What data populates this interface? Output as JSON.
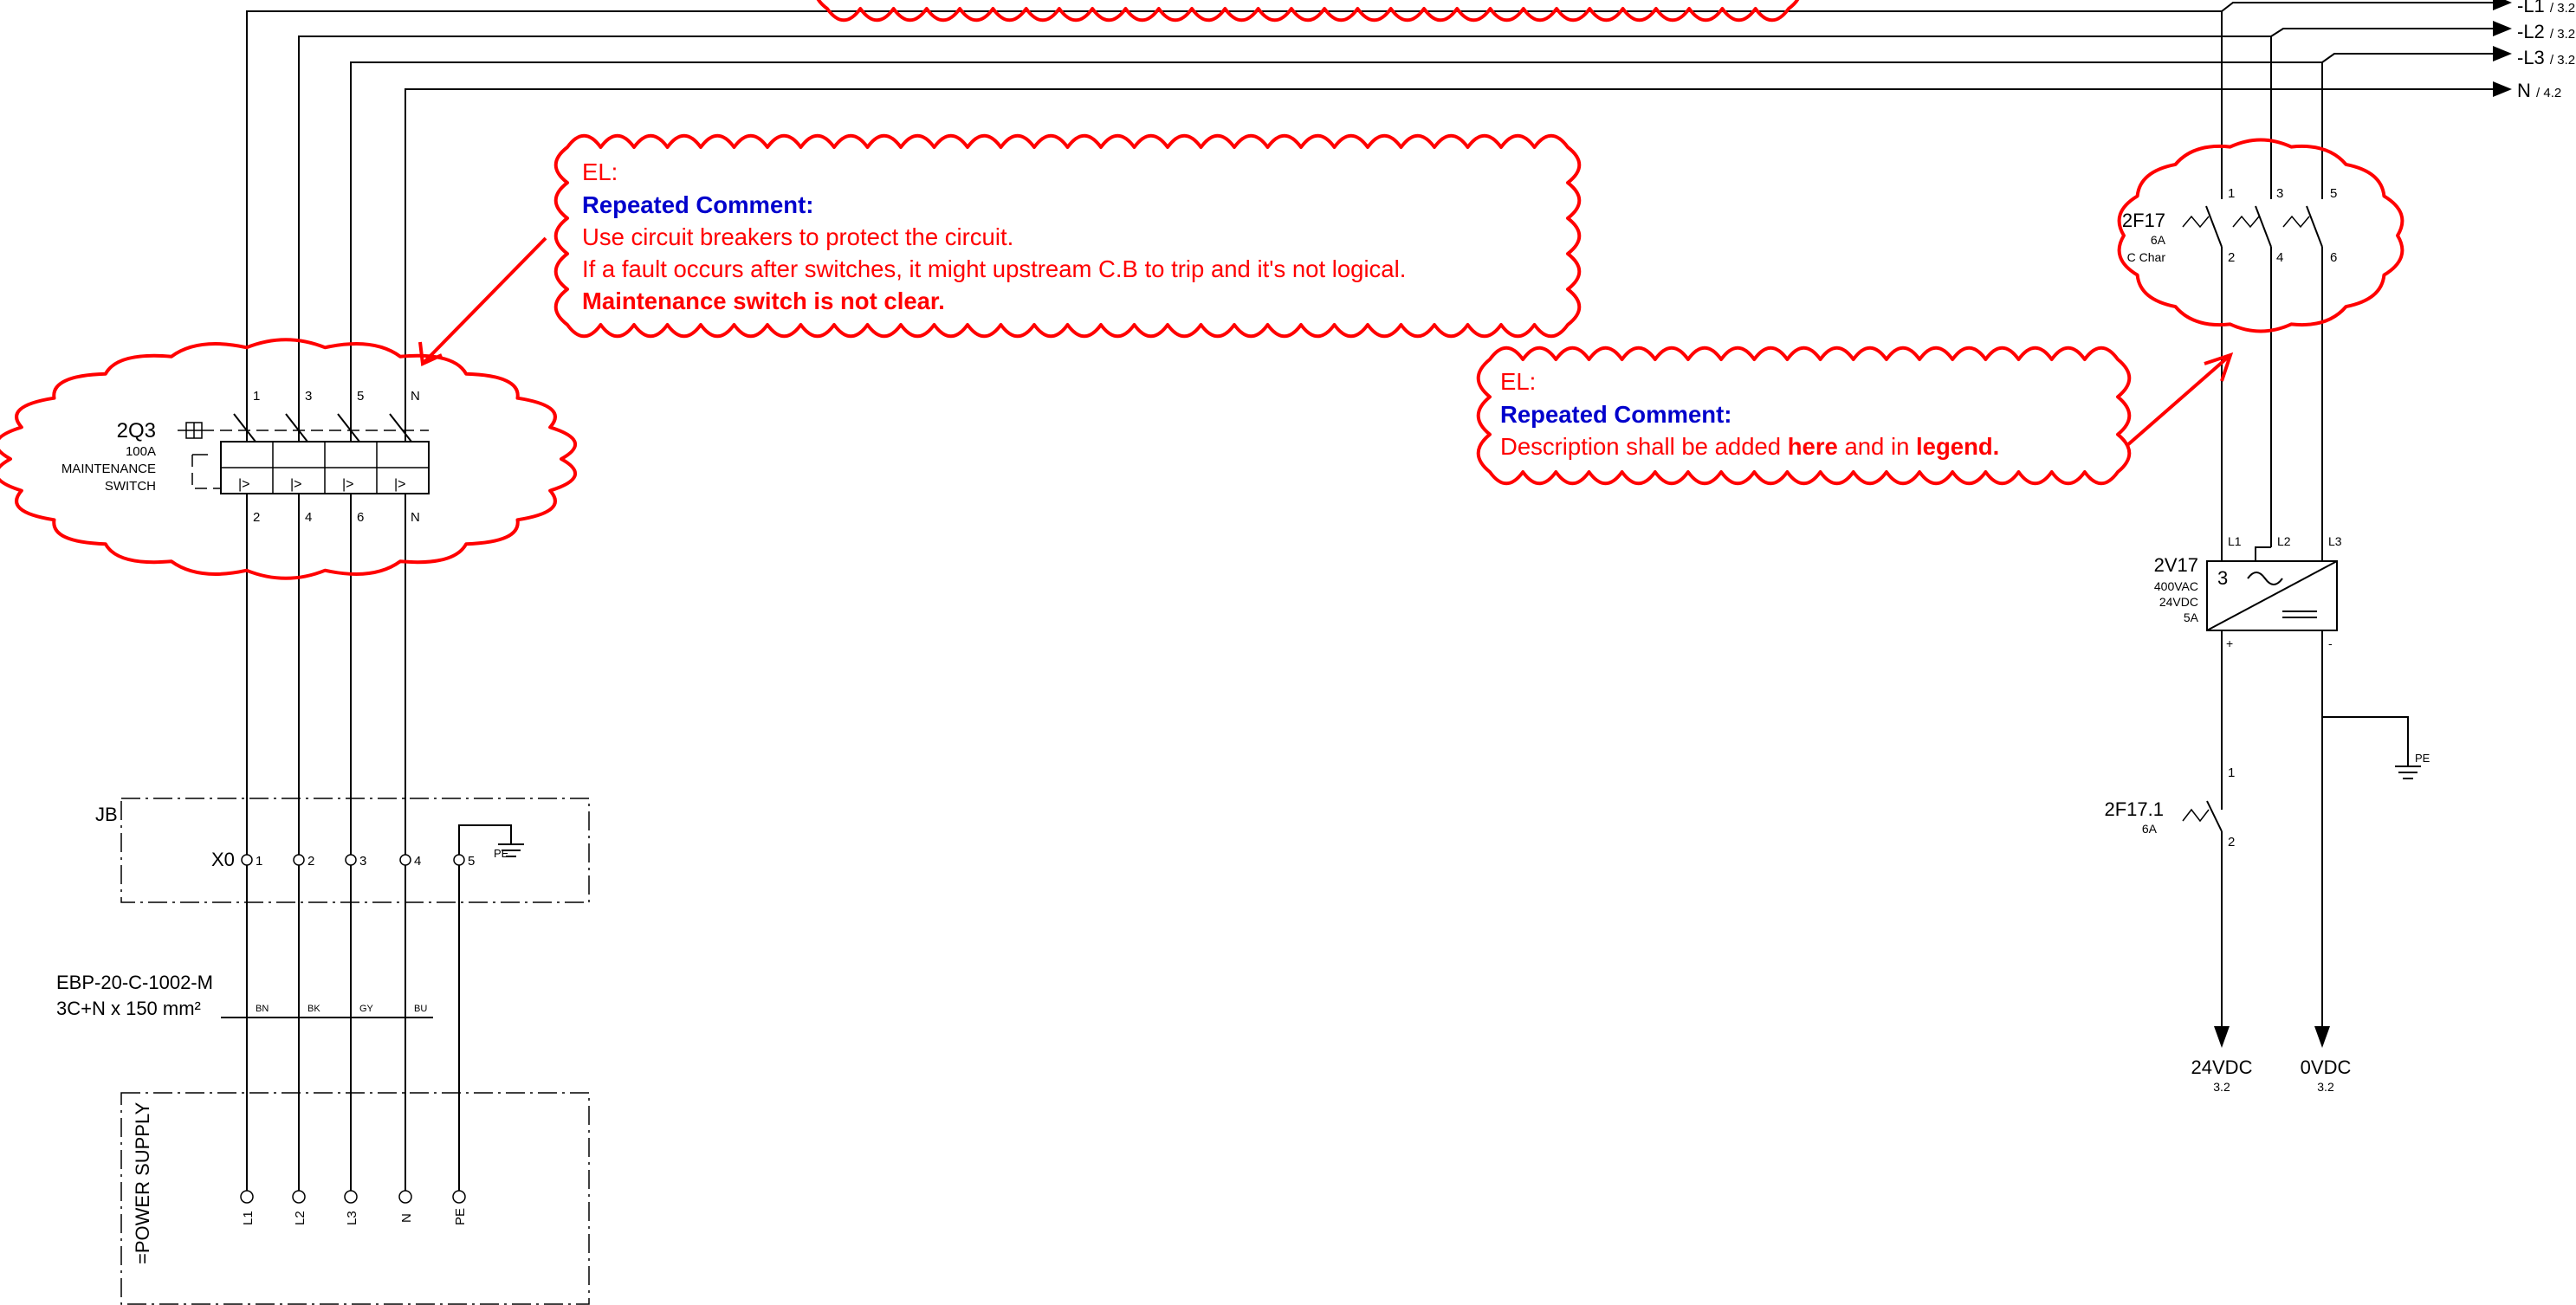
{
  "outputs": {
    "l1": {
      "name": "-L1",
      "ref": "/ 3.2"
    },
    "l2": {
      "name": "-L2",
      "ref": "/ 3.2"
    },
    "l3": {
      "name": "-L3",
      "ref": "/ 3.2"
    },
    "n": {
      "name": "N",
      "ref": "/ 4.2"
    }
  },
  "switch_2q3": {
    "tag": "2Q3",
    "rating": "100A",
    "desc1": "MAINTENANCE",
    "desc2": "SWITCH",
    "top_terminals": [
      "1",
      "3",
      "5",
      "N"
    ],
    "bottom_terminals": [
      "2",
      "4",
      "6",
      "N"
    ],
    "trip_symbol": "|>"
  },
  "breaker_2f17": {
    "tag": "2F17",
    "rating": "6A",
    "char": "C Char",
    "top_terminals": [
      "1",
      "3",
      "5"
    ],
    "bottom_terminals": [
      "2",
      "4",
      "6"
    ]
  },
  "psu_2v17": {
    "tag": "2V17",
    "input": "400VAC",
    "output": "24VDC",
    "current": "5A",
    "inputs": [
      "L1",
      "L2",
      "L3"
    ],
    "plus": "+",
    "minus": "-",
    "ac_label": "3"
  },
  "breaker_2f17_1": {
    "tag": "2F17.1",
    "rating": "6A",
    "top": "1",
    "bottom": "2"
  },
  "pe_label_right": "PE",
  "dc_outputs": {
    "v24": {
      "name": "24VDC",
      "ref": "3.2"
    },
    "v0": {
      "name": "0VDC",
      "ref": "3.2"
    }
  },
  "jb": {
    "tag": "JB",
    "strip": "X0",
    "terminals": [
      "1",
      "2",
      "3",
      "4",
      "5"
    ],
    "pe": "PE"
  },
  "cable": {
    "id": "EBP-20-C-1002-M",
    "spec": "3C+N x 150 mm²",
    "colors": [
      "BN",
      "BK",
      "GY",
      "BU"
    ]
  },
  "supply": {
    "label": "=POWER SUPPLY",
    "terminals": [
      "L1",
      "L2",
      "L3",
      "N",
      "PE"
    ]
  },
  "comment1": {
    "prefix": "EL:",
    "heading": "Repeated Comment:",
    "line1": "Use circuit breakers to protect the circuit.",
    "line2": "If a fault occurs after switches, it might upstream C.B to trip and it's not logical.",
    "line3": "Maintenance switch is not clear."
  },
  "comment2": {
    "prefix": "EL:",
    "heading": "Repeated Comment:",
    "part1": "Description shall be added ",
    "part2": "here",
    "part3": " and in ",
    "part4": "legend."
  },
  "colors": {
    "markup": "#ff0000",
    "heading": "#0000cc",
    "wire": "#000000"
  }
}
